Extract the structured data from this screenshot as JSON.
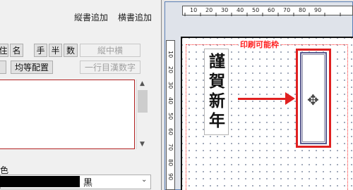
{
  "menu": {
    "vertical_add": "縦書追加",
    "horizontal_add": "横書追加"
  },
  "toolbar": {
    "row1": [
      "住",
      "名",
      "手",
      "半",
      "数"
    ],
    "tate_chu_yoko": "縦中横",
    "even_layout": "均等配置",
    "one_line_kanji_numbers": "一行目漢数字"
  },
  "color": {
    "label": "色",
    "selected_value": "黒",
    "swatch_hex": "#000000"
  },
  "preview": {
    "print_area_label": "印刷可能枠",
    "vertical_text": [
      "謹",
      "賀",
      "新",
      "年"
    ],
    "ruler_h_ticks": [
      "10",
      "20",
      "30",
      "40",
      "50",
      "60",
      "70",
      "80",
      "90"
    ],
    "ruler_v_ticks": [
      "10",
      "20",
      "30",
      "40",
      "50",
      "60",
      "70",
      "80",
      "90",
      "100"
    ],
    "accent_red": "#e02020",
    "selection_color": "#5b5b8f"
  }
}
